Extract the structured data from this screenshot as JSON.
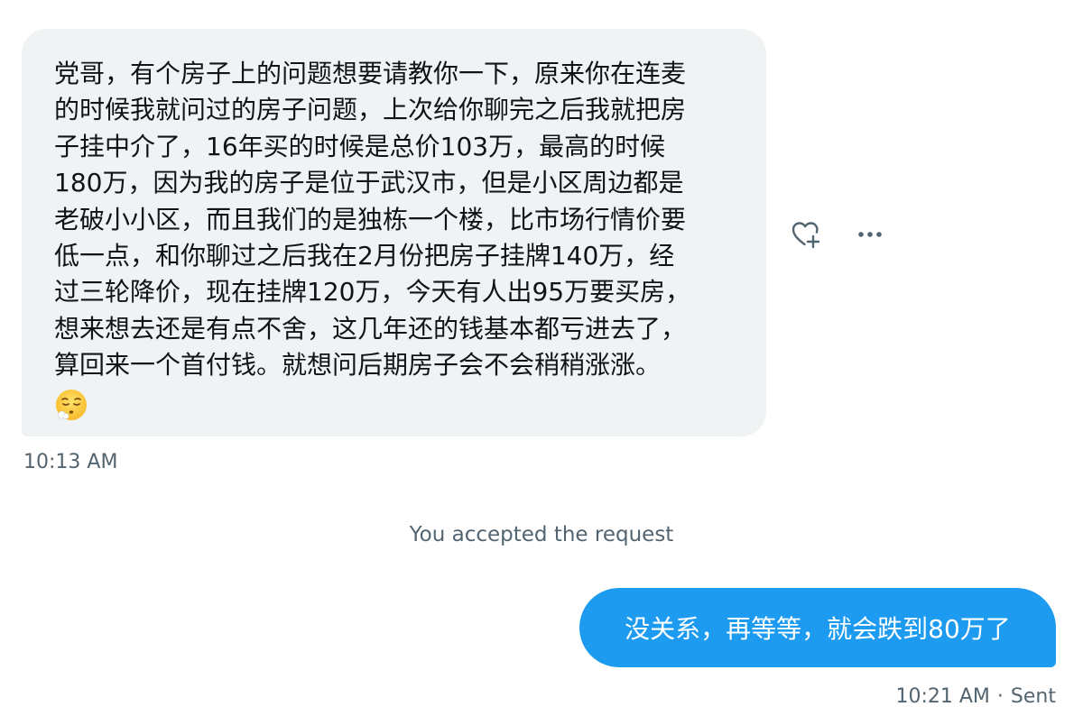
{
  "conversation": {
    "received_message": {
      "lines": [
        "党哥，有个房子上的问题想要请教你一下，原来你在连麦",
        "的时候我就问过的房子问题，上次给你聊完之后我就把房",
        "子挂中介了，16年买的时候是总价103万，最高的时候",
        "180万，因为我的房子是位于武汉市，但是小区周边都是",
        "老破小小区，而且我们的是独栋一个楼，比市场行情价要",
        "低一点，和你聊过之后我在2月份把房子挂牌140万，经",
        "过三轮降价，现在挂牌120万，今天有人出95万要买房，",
        "想来想去还是有点不舍，这几年还的钱基本都亏进去了，",
        "算回来一个首付钱。就想问后期房子会不会稍稍涨涨。"
      ],
      "emoji": "relieved-face-with-exhale",
      "timestamp": "10:13 AM",
      "actions": {
        "reaction_icon": "add-reaction-heart-icon",
        "more_icon": "more-horizontal-icon"
      }
    },
    "system_notice": "You accepted the request",
    "sent_message": {
      "text": "没关系，再等等，就会跌到80万了",
      "timestamp": "10:21 AM",
      "separator": "·",
      "status": "Sent"
    }
  },
  "colors": {
    "received_bubble": "#eff3f4",
    "sent_bubble": "#1d9bf0",
    "secondary_text": "#536471",
    "primary_text": "#0f1419"
  }
}
